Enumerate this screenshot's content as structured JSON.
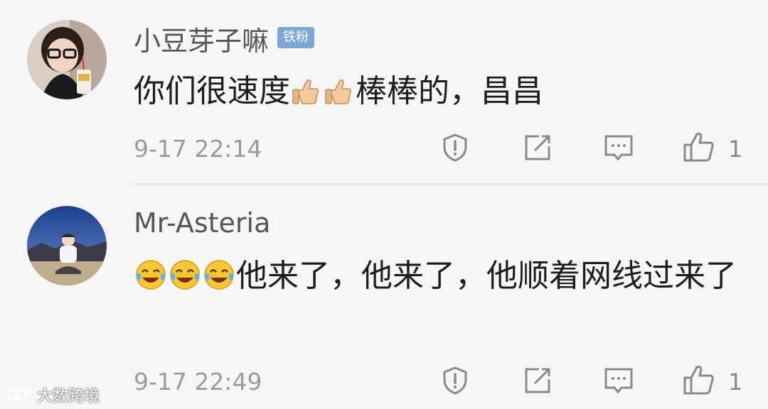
{
  "comments": [
    {
      "username": "小豆芽子嘛",
      "badge": "铁粉",
      "text_pre": "你们很速度",
      "text_post": "棒棒的，昌昌",
      "time": "9-17 22:14",
      "likes": "1"
    },
    {
      "username": "Mr-Asteria",
      "text": "他来了，他来了，他顺着网线过来了",
      "time": "9-17 22:49",
      "likes": "1"
    }
  ],
  "watermark": "大数跨境",
  "icons": {
    "report": "shield-exclamation-icon",
    "share": "share-icon",
    "reply": "comment-icon",
    "like": "thumbs-up-icon",
    "thumbs_emoji": "thumbs-up-emoji-icon",
    "laugh_cry_emoji": "tears-of-joy-emoji-icon"
  },
  "colors": {
    "background": "#f6f6f6",
    "username": "#555555",
    "time": "#9b9b9b",
    "badge": "#7aa7d8",
    "icon": "#8a8a8a"
  }
}
